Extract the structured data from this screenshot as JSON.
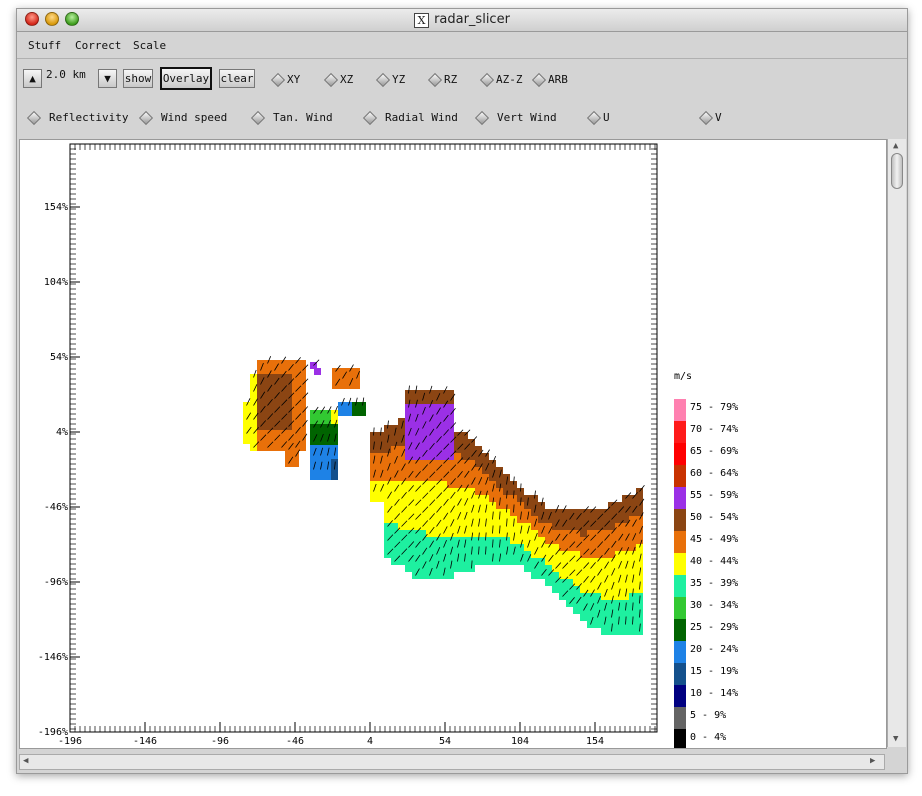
{
  "window": {
    "title": "radar_slicer"
  },
  "menu": [
    "Stuff",
    "Correct",
    "Scale"
  ],
  "toolbar": {
    "level": "2.0 km",
    "show_label": "show",
    "overlay_label": "Overlay",
    "clear_label": "clear",
    "views": [
      "XY",
      "XZ",
      "YZ",
      "RZ",
      "AZ-Z",
      "ARB"
    ],
    "fields": [
      "Reflectivity",
      "Wind speed",
      "Tan. Wind",
      "Radial Wind",
      "Vert Wind",
      "U",
      "V"
    ]
  },
  "plot": {
    "x_ticks": [
      "-196",
      "-146",
      "-96",
      "-46",
      "4",
      "54",
      "104",
      "154"
    ],
    "y_ticks": [
      "154",
      "104",
      "54",
      "4",
      "-46",
      "-96",
      "-146",
      "-196"
    ]
  },
  "legend": {
    "unit": "m/s",
    "bins": [
      {
        "label": "75 - 79%",
        "color": "#ff80b0"
      },
      {
        "label": "70 - 74%",
        "color": "#ff1a1a"
      },
      {
        "label": "65 - 69%",
        "color": "#ff0000"
      },
      {
        "label": "60 - 64%",
        "color": "#c83200"
      },
      {
        "label": "55 - 59%",
        "color": "#9b30e6"
      },
      {
        "label": "50 - 54%",
        "color": "#8b4513"
      },
      {
        "label": "45 - 49%",
        "color": "#e8700a"
      },
      {
        "label": "40 - 44%",
        "color": "#ffff00"
      },
      {
        "label": "35 - 39%",
        "color": "#1ef0a0"
      },
      {
        "label": "30 - 34%",
        "color": "#32c832"
      },
      {
        "label": "25 - 29%",
        "color": "#006400"
      },
      {
        "label": "20 - 24%",
        "color": "#1e82e6"
      },
      {
        "label": "15 - 19%",
        "color": "#14508c"
      },
      {
        "label": "10 - 14%",
        "color": "#000080"
      },
      {
        "label": "5 - 9%",
        "color": "#646464"
      },
      {
        "label": "0 - 4%",
        "color": "#000000"
      }
    ]
  }
}
